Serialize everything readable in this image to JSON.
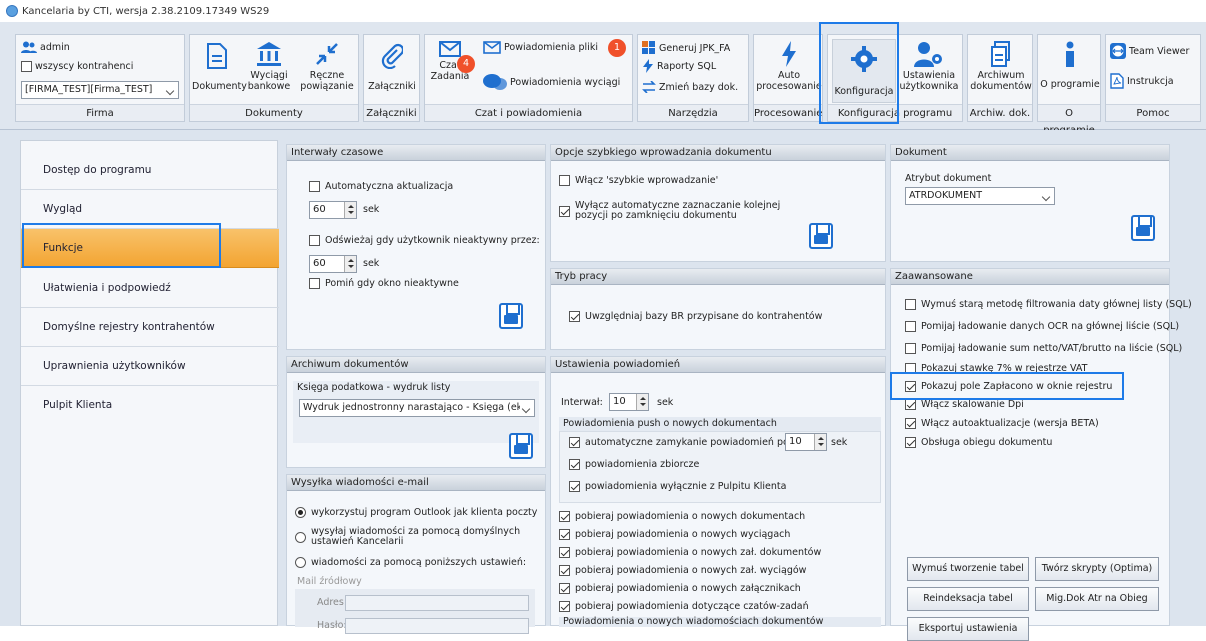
{
  "window": {
    "title": "Kancelaria by CTI, wersja  2.38.2109.17349 WS29"
  },
  "ribbon": {
    "firma": {
      "user": "admin",
      "all_contractors": "wszyscy kontrahenci",
      "company_select": "[FIRMA_TEST][Firma_TEST]",
      "caption": "Firma"
    },
    "dokumenty": {
      "documents": "Dokumenty",
      "bank_statements_1": "Wyciągi",
      "bank_statements_2": "bankowe",
      "manual_1": "Ręczne",
      "manual_2": "powiązanie",
      "caption": "Dokumenty"
    },
    "zalaczniki": {
      "attachments": "Załączniki",
      "caption": "Załączniki"
    },
    "czat": {
      "notif_files": "Powiadomienia pliki",
      "notif_badge": "1",
      "chat_1": "Czat",
      "chat_2": "Zadania",
      "chat_badge": "4",
      "notif_statements": "Powiadomienia wyciągi",
      "caption": "Czat i powiadomienia"
    },
    "narzedzia": {
      "jpk": "Generuj JPK_FA",
      "sql": "Raporty SQL",
      "change_db": "Zmień bazy dok.",
      "caption": "Narzędzia"
    },
    "procesowanie": {
      "auto_1": "Auto",
      "auto_2": "procesowanie",
      "caption": "Procesowanie"
    },
    "konfiguracja": {
      "config": "Konfiguracja",
      "user_settings_1": "Ustawienia",
      "user_settings_2": "użytkownika",
      "caption": "Konfiguracja programu"
    },
    "archiwum": {
      "archive_1": "Archiwum",
      "archive_2": "dokumentów",
      "caption": "Archiw. dok."
    },
    "oprogramie": {
      "about": "O programie",
      "caption": "O programie"
    },
    "pomoc": {
      "teamviewer": "Team Viewer",
      "manual": "Instrukcja",
      "caption": "Pomoc"
    }
  },
  "nav": {
    "items": [
      "Dostęp do programu",
      "Wygląd",
      "Funkcje",
      "Ułatwienia i podpowiedź",
      "Domyślne rejestry kontrahentów",
      "Uprawnienia użytkowników",
      "Pulpit Klienta"
    ]
  },
  "interwaly": {
    "title": "Interwały czasowe",
    "auto_update": "Automatyczna aktualizacja",
    "val1": "60",
    "unit": "sek",
    "refresh_inactive": "Odświeżaj gdy użytkownik nieaktywny przez:",
    "val2": "60",
    "skip_inactive": "Pomiń gdy okno nieaktywne"
  },
  "archiwum": {
    "title": "Archiwum dokumentów",
    "ledger_label": "Księga podatkowa - wydruk listy",
    "ledger_value": "Wydruk jednostronny narastająco - Księga (ek"
  },
  "email": {
    "title": "Wysyłka wiadomości e-mail",
    "opt1": "wykorzystuj program Outlook jak klienta poczty",
    "opt2a": "wysyłaj wiadomości za pomocą domyślnych",
    "opt2b": "ustawień Kancelarii",
    "opt3": "wiadomości za pomocą poniższych ustawień:",
    "source": "Mail źródłowy",
    "address": "Adres:",
    "password": "Hasło:"
  },
  "szybkie": {
    "title": "Opcje szybkiego wprowadzania dokumentu",
    "enable": "Włącz 'szybkie wprowadzanie'",
    "disable_auto_1": "Wyłącz automatyczne zaznaczanie kolejnej",
    "disable_auto_2": "pozycji po zamknięciu dokumentu"
  },
  "tryb": {
    "title": "Tryb pracy",
    "include_br": "Uwzględniaj bazy BR przypisane do kontrahentów"
  },
  "powiadomienia": {
    "title": "Ustawienia powiadomień",
    "interval_label": "Interwał:",
    "interval_value": "10",
    "unit": "sek",
    "push_header": "Powiadomienia push o nowych dokumentach",
    "auto_close": "automatyczne zamykanie powiadomień po:",
    "auto_close_value": "10",
    "collective": "powiadomienia zbiorcze",
    "only_portal": "powiadomienia wyłącznie z Pulpitu Klienta",
    "fetch": [
      "pobieraj powiadomienia o nowych dokumentach",
      "pobieraj powiadomienia o nowych wyciągach",
      "pobieraj powiadomienia o nowych zał. dokumentów",
      "pobieraj powiadomienia o nowych zał. wyciągów",
      "pobieraj powiadomienia o nowych załącznikach",
      "pobieraj powiadomienia dotyczące czatów-zadań"
    ],
    "messages_header": "Powiadomienia o nowych wiadomościach dokumentów"
  },
  "dokument": {
    "title": "Dokument",
    "attr_label": "Atrybut dokument",
    "attr_value": "ATRDOKUMENT"
  },
  "zaawansowane": {
    "title": "Zaawansowane",
    "options": [
      {
        "label": "Wymuś starą metodę filtrowania daty głównej listy (SQL)",
        "checked": false
      },
      {
        "label": "Pomijaj ładowanie danych OCR na głównej liście (SQL)",
        "checked": false
      },
      {
        "label": "Pomijaj ładowanie sum netto/VAT/brutto na liście (SQL)",
        "checked": false
      },
      {
        "label": "Pokazuj stawkę 7% w rejestrze VAT",
        "checked": false
      },
      {
        "label": "Pokazuj pole Zapłacono w oknie rejestru",
        "checked": true
      },
      {
        "label": "Włącz skalowanie Dpi",
        "checked": true
      },
      {
        "label": "Włącz autoaktualizacje (wersja BETA)",
        "checked": true
      },
      {
        "label": "Obsługa obiegu dokumentu",
        "checked": true
      }
    ],
    "btn_force_tables": "Wymuś tworzenie tabel",
    "btn_scripts": "Twórz skrypty (Optima)",
    "btn_reindex": "Reindeksacja tabel",
    "btn_migrate": "Mig.Dok Atr na Obieg",
    "btn_export": "Eksportuj ustawienia"
  },
  "colors": {
    "accent": "#1e7be8",
    "active_nav": "#f3a431",
    "badge": "#f0502a"
  }
}
